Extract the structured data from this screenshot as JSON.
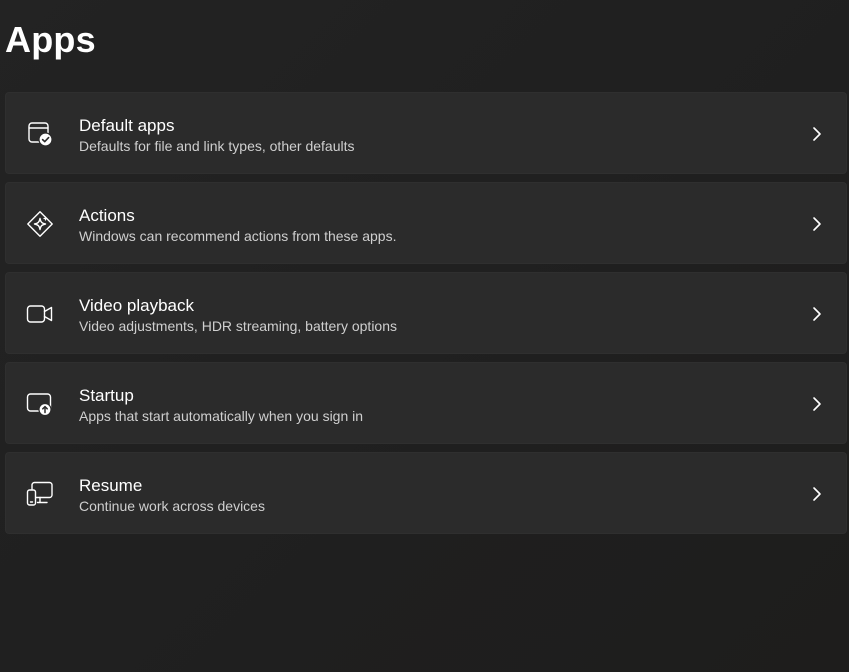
{
  "page": {
    "title": "Apps"
  },
  "items": [
    {
      "title": "Default apps",
      "subtitle": "Defaults for file and link types, other defaults",
      "icon": "default-apps-icon"
    },
    {
      "title": "Actions",
      "subtitle": "Windows can recommend actions from these apps.",
      "icon": "actions-sparkle-icon"
    },
    {
      "title": "Video playback",
      "subtitle": "Video adjustments, HDR streaming, battery options",
      "icon": "video-camera-icon"
    },
    {
      "title": "Startup",
      "subtitle": "Apps that start automatically when you sign in",
      "icon": "startup-icon"
    },
    {
      "title": "Resume",
      "subtitle": "Continue work across devices",
      "icon": "devices-icon"
    }
  ],
  "colors": {
    "background": "#202020",
    "card": "#2b2b2b",
    "text_primary": "#ffffff",
    "text_secondary": "#cfcfcf"
  }
}
